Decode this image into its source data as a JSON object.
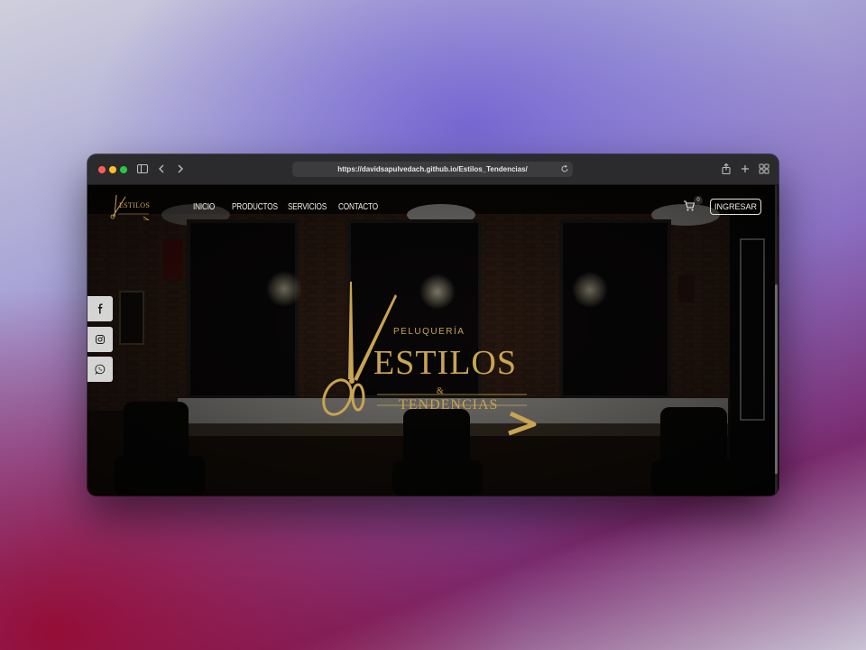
{
  "browser": {
    "url": "https://davidsapulvedach.github.io/Estilos_Tendencias/"
  },
  "site": {
    "logo_text": "ESTILOS",
    "nav": [
      {
        "label": "INICIO"
      },
      {
        "label": "PRODUCTOS"
      },
      {
        "label": "SERVICIOS"
      },
      {
        "label": "CONTACTO"
      }
    ],
    "cart_count": "0",
    "login_label": "INGRESAR"
  },
  "social": [
    {
      "name": "facebook-icon"
    },
    {
      "name": "instagram-icon"
    },
    {
      "name": "whatsapp-icon"
    }
  ],
  "hero": {
    "kicker": "PELUQUERÍA",
    "title": "ESTILOS",
    "ampersand": "&",
    "subtitle": "TENDENCIAS"
  },
  "colors": {
    "gold": "#c9a452",
    "dark_bg": "#1c1612"
  }
}
